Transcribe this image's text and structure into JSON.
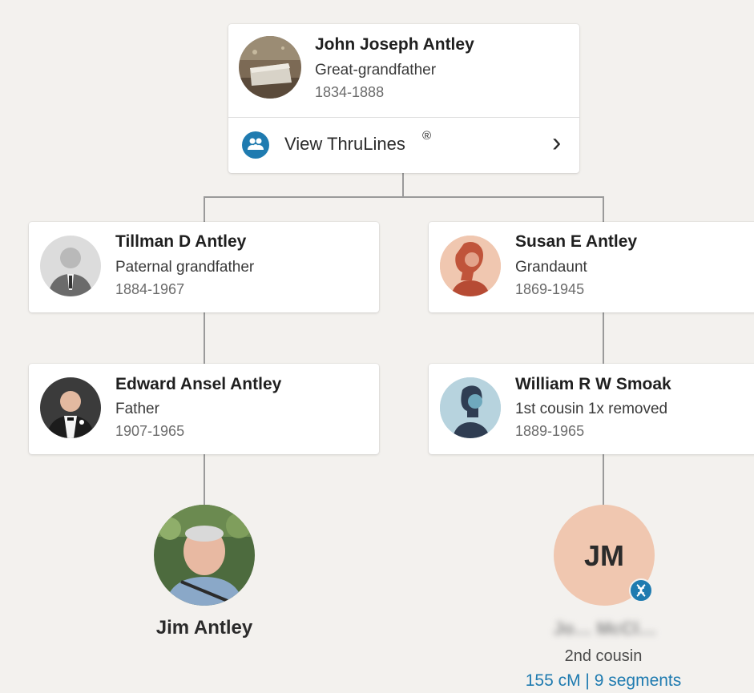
{
  "colors": {
    "background": "#f3f1ee",
    "card": "#ffffff",
    "connector": "#9a9a9a",
    "accent_blue": "#1f7bb0",
    "match_avatar": "#f0c7b0"
  },
  "ancestor": {
    "name": "John Joseph Antley",
    "relationship": "Great-grandfather",
    "dates": "1834-1888",
    "thrulines_label": "View ThruLines",
    "thrulines_mark": "®",
    "thrulines_icon": "people-group-icon",
    "chevron": "›"
  },
  "left_branch": {
    "grandparent": {
      "name": "Tillman D Antley",
      "relationship": "Paternal grandfather",
      "dates": "1884-1967"
    },
    "parent": {
      "name": "Edward Ansel Antley",
      "relationship": "Father",
      "dates": "1907-1965"
    },
    "self": {
      "name": "Jim Antley"
    }
  },
  "right_branch": {
    "grandparent": {
      "name": "Susan E Antley",
      "relationship": "Grandaunt",
      "dates": "1869-1945"
    },
    "parent": {
      "name": "William R W Smoak",
      "relationship": "1st cousin 1x removed",
      "dates": "1889-1965"
    },
    "match": {
      "initials": "JM",
      "name": "Jo… McCl…",
      "relationship": "2nd cousin",
      "dna": "155 cM | 9 segments",
      "badge_icon": "dna-icon"
    }
  }
}
